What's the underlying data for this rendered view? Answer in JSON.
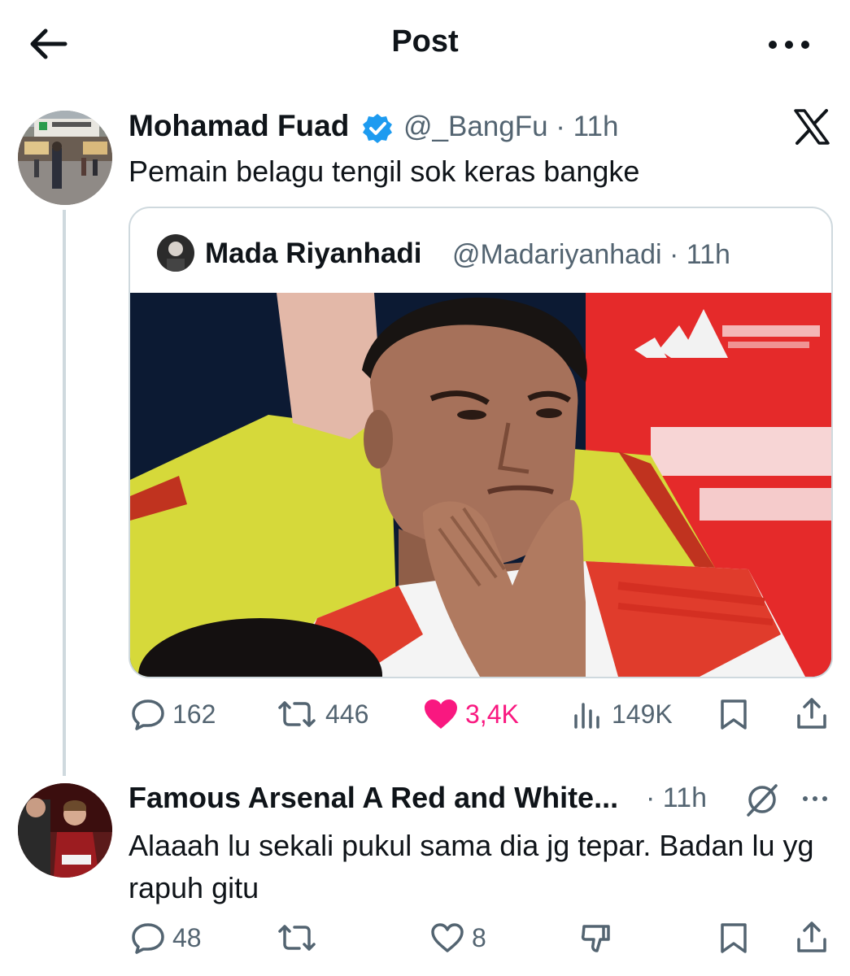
{
  "header": {
    "title": "Post"
  },
  "post": {
    "author_name": "Mohamad Fuad",
    "handle_time": "@_BangFu · 11h",
    "text": "Pemain belagu tengil sok keras bangke",
    "quote": {
      "author_name": "Mada Riyanhadi",
      "handle_time": "@Madariyanhadi · 11h"
    },
    "actions": {
      "replies": "162",
      "reposts": "446",
      "likes": "3,4K",
      "views": "149K"
    }
  },
  "reply": {
    "author_name": "Famous Arsenal A Red and White...",
    "time": "· 11h",
    "text": "Alaaah lu sekali pukul sama dia jg tepar. Badan lu yg rapuh gitu",
    "actions": {
      "replies": "48",
      "reposts": "",
      "likes": "8"
    }
  },
  "colors": {
    "text": "#0f1419",
    "secondary": "#536471",
    "like": "#f91880",
    "verified": "#1d9bf0",
    "border": "#cfd9de"
  },
  "icons": [
    "back-arrow-icon",
    "more-icon",
    "verified-badge-icon",
    "x-logo-icon",
    "reply-icon",
    "repost-icon",
    "like-icon",
    "views-icon",
    "bookmark-icon",
    "share-icon",
    "grok-icon",
    "downvote-icon"
  ]
}
